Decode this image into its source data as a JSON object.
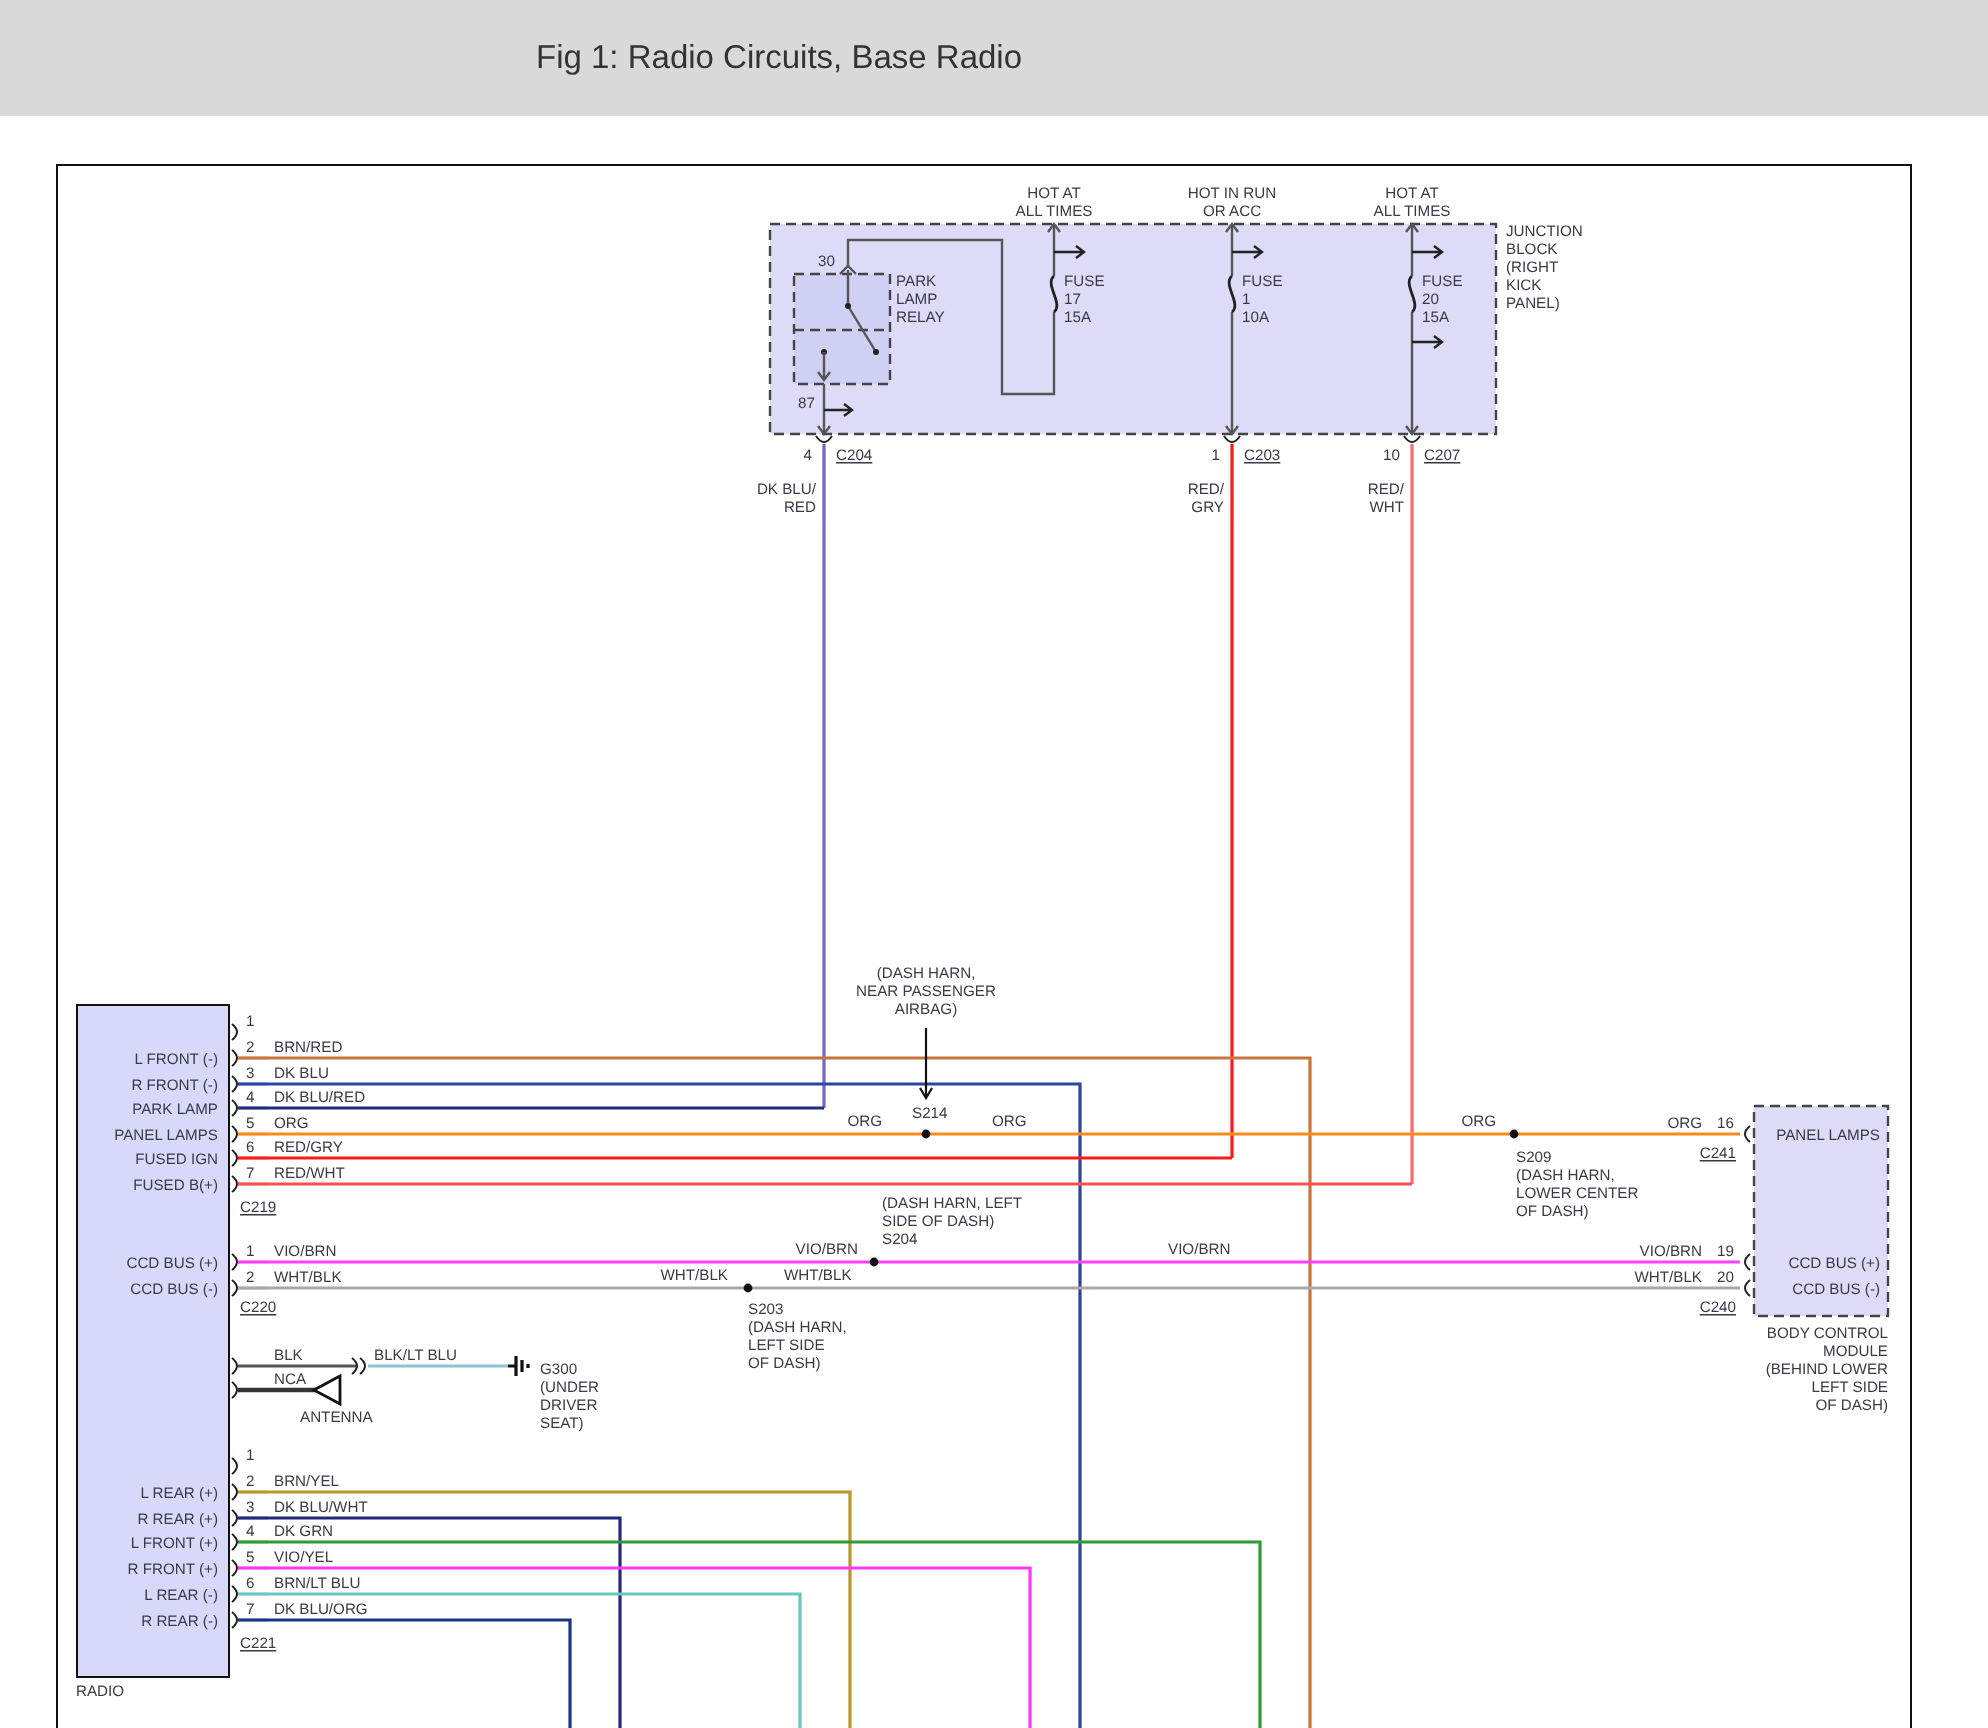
{
  "title": "Fig 1: Radio Circuits, Base Radio",
  "junction_block": {
    "label": [
      "JUNCTION",
      "BLOCK",
      "(RIGHT",
      "KICK",
      "PANEL)"
    ],
    "relay": {
      "label": [
        "PARK",
        "LAMP",
        "RELAY"
      ],
      "pins": [
        "30",
        "87"
      ]
    },
    "feeds": [
      {
        "source": [
          "HOT AT",
          "ALL TIMES"
        ],
        "fuse": [
          "FUSE",
          "17",
          "15A"
        ]
      },
      {
        "source": [
          "HOT IN RUN",
          "OR ACC"
        ],
        "fuse": [
          "FUSE",
          "1",
          "10A"
        ]
      },
      {
        "source": [
          "HOT AT",
          "ALL TIMES"
        ],
        "fuse": [
          "FUSE",
          "20",
          "15A"
        ]
      }
    ],
    "outputs": [
      {
        "pin": "4",
        "connector": "C204",
        "wire": [
          "DK BLU/",
          "RED"
        ],
        "color": "#7565c5"
      },
      {
        "pin": "1",
        "connector": "C203",
        "wire": [
          "RED/",
          "GRY"
        ],
        "color": "#ff1a1a"
      },
      {
        "pin": "10",
        "connector": "C207",
        "wire": [
          "RED/",
          "WHT"
        ],
        "color": "#ff6a6a"
      }
    ]
  },
  "radio": {
    "label": "RADIO",
    "connectors": [
      {
        "name": "C219",
        "pins": [
          {
            "pin": "1"
          },
          {
            "pin": "2",
            "function": "L FRONT (-)",
            "wire": "BRN/RED",
            "color": "#c8743c"
          },
          {
            "pin": "3",
            "function": "R FRONT (-)",
            "wire": "DK BLU",
            "color": "#2a44a0"
          },
          {
            "pin": "4",
            "function": "PARK LAMP",
            "wire": "DK BLU/RED",
            "color": "#1c2c80"
          },
          {
            "pin": "5",
            "function": "PANEL LAMPS",
            "wire": "ORG",
            "color": "#ff8a1a"
          },
          {
            "pin": "6",
            "function": "FUSED IGN",
            "wire": "RED/GRY",
            "color": "#ff1a1a"
          },
          {
            "pin": "7",
            "function": "FUSED B(+)",
            "wire": "RED/WHT",
            "color": "#ff5050"
          }
        ]
      },
      {
        "name": "C220",
        "pins": [
          {
            "pin": "1",
            "function": "CCD BUS (+)",
            "wire": "VIO/BRN",
            "color": "#ff40ff"
          },
          {
            "pin": "2",
            "function": "CCD BUS (-)",
            "wire": "WHT/BLK",
            "color": "#a8a8a8"
          }
        ]
      },
      {
        "name": "C221",
        "pins": [
          {
            "pin": "1"
          },
          {
            "pin": "2",
            "function": "L REAR (+)",
            "wire": "BRN/YEL",
            "color": "#b89628"
          },
          {
            "pin": "3",
            "function": "R REAR (+)",
            "wire": "DK BLU/WHT",
            "color": "#25287a"
          },
          {
            "pin": "4",
            "function": "L FRONT (+)",
            "wire": "DK GRN",
            "color": "#2e9a34"
          },
          {
            "pin": "5",
            "function": "R FRONT (+)",
            "wire": "VIO/YEL",
            "color": "#ff38ff"
          },
          {
            "pin": "6",
            "function": "L REAR (-)",
            "wire": "BRN/LT BLU",
            "color": "#6cc6c0"
          },
          {
            "pin": "7",
            "function": "R REAR (-)",
            "wire": "DK BLU/ORG",
            "color": "#1a3488"
          }
        ]
      }
    ],
    "ground": {
      "wire": "BLK",
      "wire_2": "BLK/LT BLU",
      "label": [
        "G300",
        "(UNDER",
        "DRIVER",
        "SEAT)"
      ]
    },
    "antenna": {
      "wire": "NCA",
      "label": "ANTENNA"
    }
  },
  "splices": [
    {
      "name": "S214",
      "location": [
        "(DASH HARN,",
        "NEAR PASSENGER",
        "AIRBAG)"
      ],
      "wire_labels": [
        "ORG",
        "ORG"
      ]
    },
    {
      "name": "S209",
      "location": [
        "(DASH HARN,",
        "LOWER CENTER",
        "OF DASH)"
      ],
      "wire_labels": [
        "ORG"
      ]
    },
    {
      "name": "S204",
      "location": [
        "(DASH HARN, LEFT",
        "SIDE OF DASH)"
      ],
      "wire_labels": [
        "VIO/BRN",
        "VIO/BRN"
      ]
    },
    {
      "name": "S203",
      "location": [
        "(DASH HARN,",
        "LEFT SIDE",
        "OF DASH)"
      ],
      "wire_labels": [
        "WHT/BLK",
        "WHT/BLK"
      ]
    }
  ],
  "body_control_module": {
    "label": [
      "BODY CONTROL",
      "MODULE",
      "(BEHIND LOWER",
      "LEFT SIDE",
      "OF DASH)"
    ],
    "pins": [
      {
        "function": "PANEL LAMPS",
        "pin": "16",
        "wire": "ORG",
        "connector": "C241"
      },
      {
        "function": "CCD BUS (+)",
        "pin": "19",
        "wire": "VIO/BRN"
      },
      {
        "function": "CCD BUS (-)",
        "pin": "20",
        "wire": "WHT/BLK",
        "connector": "C240"
      }
    ]
  }
}
